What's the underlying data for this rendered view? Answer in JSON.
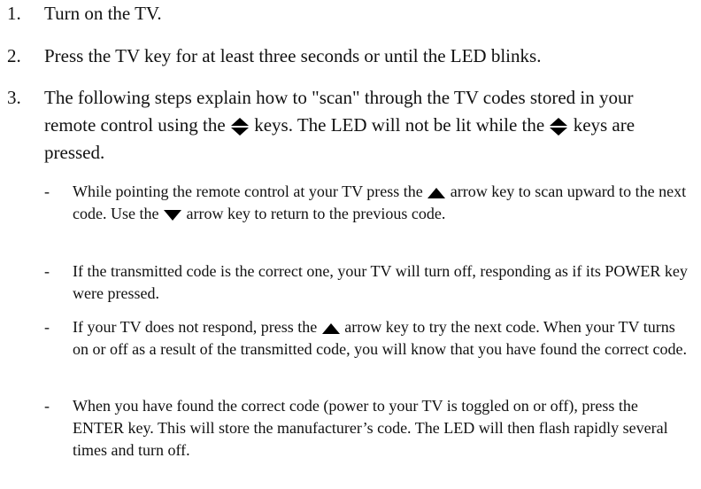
{
  "steps": [
    {
      "num": "1.",
      "text": "Turn on the TV."
    },
    {
      "num": "2.",
      "text": "Press the TV key for at least three seconds or until the LED blinks."
    },
    {
      "num": "3.",
      "text_a": "The following steps explain how to \"scan\" through the TV codes stored in your remote control using the",
      "text_b": "keys. The LED will not be lit while the",
      "text_c": "keys are pressed."
    }
  ],
  "substeps": [
    {
      "dash": "-",
      "text_a": "While pointing the remote control at your TV press the",
      "text_b": "arrow key to scan upward to the next code. Use the",
      "text_c": "arrow key to return to the previous code."
    },
    {
      "dash": "-",
      "text": "If the transmitted code is the correct one, your TV will turn off, responding as if its POWER key were pressed."
    },
    {
      "dash": "-",
      "text_a": "If your TV does not respond, press the",
      "text_b": "arrow key to try the next code. When your TV turns on or off as a result of the transmitted code, you will know that you have found the correct code."
    },
    {
      "dash": "-",
      "text": "When you have found the correct code (power to your TV is toggled on or off), press the ENTER key. This will store the manufacturer’s code. The LED will then flash rapidly several times and turn off."
    }
  ],
  "icons": {
    "updown": "up-down-arrow-keys-icon",
    "up": "up-arrow-key-icon",
    "down": "down-arrow-key-icon"
  }
}
